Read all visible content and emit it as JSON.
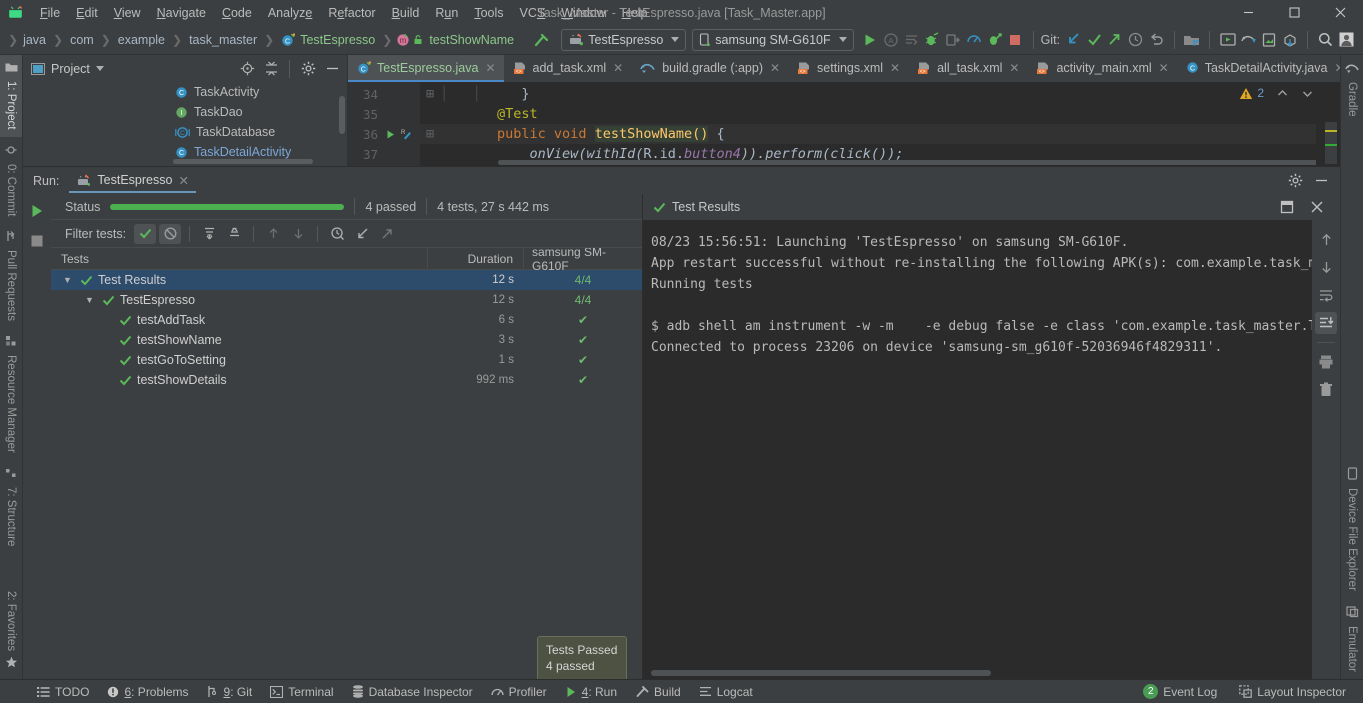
{
  "window": {
    "title": "Task_Master - TestEspresso.java [Task_Master.app]",
    "minimize": "—",
    "maximize": "❐",
    "close": "✕"
  },
  "menu": {
    "items": [
      {
        "label": "File"
      },
      {
        "label": "Edit"
      },
      {
        "label": "View"
      },
      {
        "label": "Navigate"
      },
      {
        "label": "Code"
      },
      {
        "label": "Analyze"
      },
      {
        "label": "Refactor"
      },
      {
        "label": "Build"
      },
      {
        "label": "Run"
      },
      {
        "label": "Tools"
      },
      {
        "label": "VCS"
      },
      {
        "label": "Window"
      },
      {
        "label": "Help"
      }
    ]
  },
  "navbar": {
    "breadcrumbs": [
      {
        "label": "java"
      },
      {
        "label": "com"
      },
      {
        "label": "example"
      },
      {
        "label": "task_master"
      },
      {
        "label": "TestEspresso"
      },
      {
        "label": "testShowName"
      }
    ],
    "run_config": "TestEspresso",
    "device": "samsung SM-G610F",
    "git_label": "Git:"
  },
  "project_pane": {
    "title": "Project",
    "tree": [
      {
        "label": "TaskActivity",
        "icon": "class-icon",
        "color": "normal"
      },
      {
        "label": "TaskDao",
        "icon": "interface-icon",
        "color": "normal"
      },
      {
        "label": "TaskDatabase",
        "icon": "abstract-class-icon",
        "color": "normal"
      },
      {
        "label": "TaskDetailActivity",
        "icon": "class-icon",
        "color": "blue"
      }
    ]
  },
  "editor": {
    "tabs": [
      {
        "label": "TestEspresso.java",
        "icon": "java-test-icon",
        "active": true
      },
      {
        "label": "add_task.xml",
        "icon": "android-xml-icon",
        "active": false
      },
      {
        "label": "build.gradle (:app)",
        "icon": "gradle-icon",
        "active": false
      },
      {
        "label": "settings.xml",
        "icon": "android-xml-icon",
        "active": false
      },
      {
        "label": "all_task.xml",
        "icon": "android-xml-icon",
        "active": false
      },
      {
        "label": "activity_main.xml",
        "icon": "android-xml-icon",
        "active": false
      },
      {
        "label": "TaskDetailActivity.java",
        "icon": "java-class-icon",
        "active": false
      }
    ],
    "warning_count": "2",
    "lines": [
      {
        "number": "34",
        "text": "        }"
      },
      {
        "number": "35",
        "text": "    @Test"
      },
      {
        "number": "36",
        "text": "    public void testShowName() {"
      },
      {
        "number": "37",
        "text": "        onView(withId(R.id.button4)).perform(click());"
      }
    ]
  },
  "run_window": {
    "label": "Run:",
    "tab": "TestEspresso",
    "status_label": "Status",
    "passed_count": "4 passed",
    "summary": "4 tests, 27 s 442 ms",
    "filter_label": "Filter tests:",
    "columns": [
      "Tests",
      "Duration",
      "samsung SM-G610F"
    ],
    "rows": [
      {
        "name": "Test Results",
        "duration": "12 s",
        "result": "4/4",
        "depth": 0,
        "expanded": true,
        "selected": true
      },
      {
        "name": "TestEspresso",
        "duration": "12 s",
        "result": "4/4",
        "depth": 1,
        "expanded": true,
        "selected": false
      },
      {
        "name": "testAddTask",
        "duration": "6 s",
        "result": "✔",
        "depth": 2,
        "expanded": false,
        "selected": false
      },
      {
        "name": "testShowName",
        "duration": "3 s",
        "result": "✔",
        "depth": 2,
        "expanded": false,
        "selected": false
      },
      {
        "name": "testGoToSetting",
        "duration": "1 s",
        "result": "✔",
        "depth": 2,
        "expanded": false,
        "selected": false
      },
      {
        "name": "testShowDetails",
        "duration": "992 ms",
        "result": "✔",
        "depth": 2,
        "expanded": false,
        "selected": false
      }
    ]
  },
  "console": {
    "title": "Test Results",
    "output": "08/23 15:56:51: Launching 'TestEspresso' on samsung SM-G610F.\nApp restart successful without re-installing the following APK(s): com.example.task_ma\nRunning tests\n\n$ adb shell am instrument -w -m    -e debug false -e class 'com.example.task_master.Te\nConnected to process 23206 on device 'samsung-sm_g610f-52036946f4829311'."
  },
  "tooltip": {
    "title": "Tests Passed",
    "subtitle": "4 passed"
  },
  "left_rail": {
    "items": [
      {
        "label": "1: Project",
        "icon": "project-folder-icon",
        "active": true
      },
      {
        "label": "0: Commit",
        "icon": "commit-icon",
        "active": false
      },
      {
        "label": "Pull Requests",
        "icon": "pull-request-icon",
        "active": false
      },
      {
        "label": "Resource Manager",
        "icon": "resource-manager-icon",
        "active": false
      },
      {
        "label": "7: Structure",
        "icon": "structure-icon",
        "active": false
      },
      {
        "label": "2: Favorites",
        "icon": "star-icon",
        "active": false
      }
    ]
  },
  "right_rail": {
    "items": [
      {
        "label": "Gradle",
        "icon": "gradle-elephant-icon"
      },
      {
        "label": "Device File Explorer",
        "icon": "device-icon"
      },
      {
        "label": "Emulator",
        "icon": "emulator-icon"
      }
    ]
  },
  "statusbar": {
    "left_items": [
      {
        "label": "TODO",
        "icon": "todo-icon"
      },
      {
        "label": "6: Problems",
        "icon": "problems-icon"
      },
      {
        "label": "9: Git",
        "icon": "git-icon"
      },
      {
        "label": "Terminal",
        "icon": "terminal-icon"
      },
      {
        "label": "Database Inspector",
        "icon": "database-icon"
      },
      {
        "label": "Profiler",
        "icon": "profiler-icon"
      },
      {
        "label": "4: Run",
        "icon": "run-icon"
      },
      {
        "label": "Build",
        "icon": "build-hammer-icon"
      },
      {
        "label": "Logcat",
        "icon": "logcat-icon"
      }
    ],
    "event_log": {
      "label": "Event Log",
      "badge": "2"
    },
    "layout_inspector": {
      "label": "Layout Inspector"
    }
  },
  "colors": {
    "accent_green": "#499c54",
    "tab_underline": "#4a88c7",
    "selection_blue": "#2d4b6b",
    "warning_yellow": "#e0a722"
  }
}
